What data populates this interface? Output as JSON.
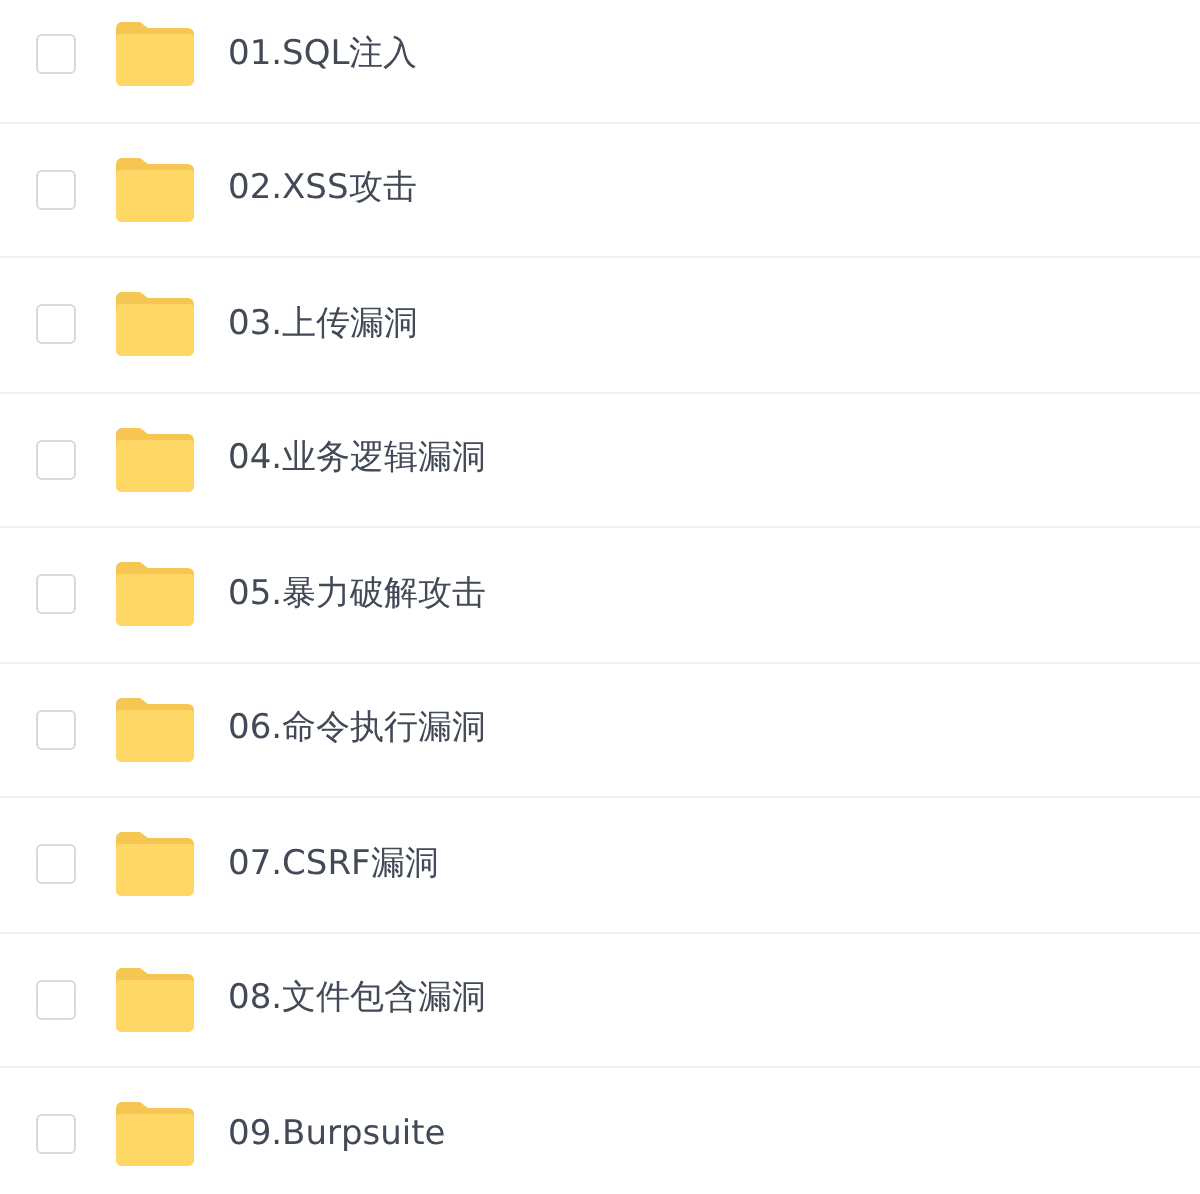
{
  "files": [
    {
      "name": "01.SQL注入",
      "checked": false
    },
    {
      "name": "02.XSS攻击",
      "checked": false
    },
    {
      "name": "03.上传漏洞",
      "checked": false
    },
    {
      "name": "04.业务逻辑漏洞",
      "checked": false
    },
    {
      "name": "05.暴力破解攻击",
      "checked": false
    },
    {
      "name": "06.命令执行漏洞",
      "checked": false
    },
    {
      "name": "07.CSRF漏洞",
      "checked": false
    },
    {
      "name": "08.文件包含漏洞",
      "checked": false
    },
    {
      "name": "09.Burpsuite",
      "checked": false
    }
  ]
}
